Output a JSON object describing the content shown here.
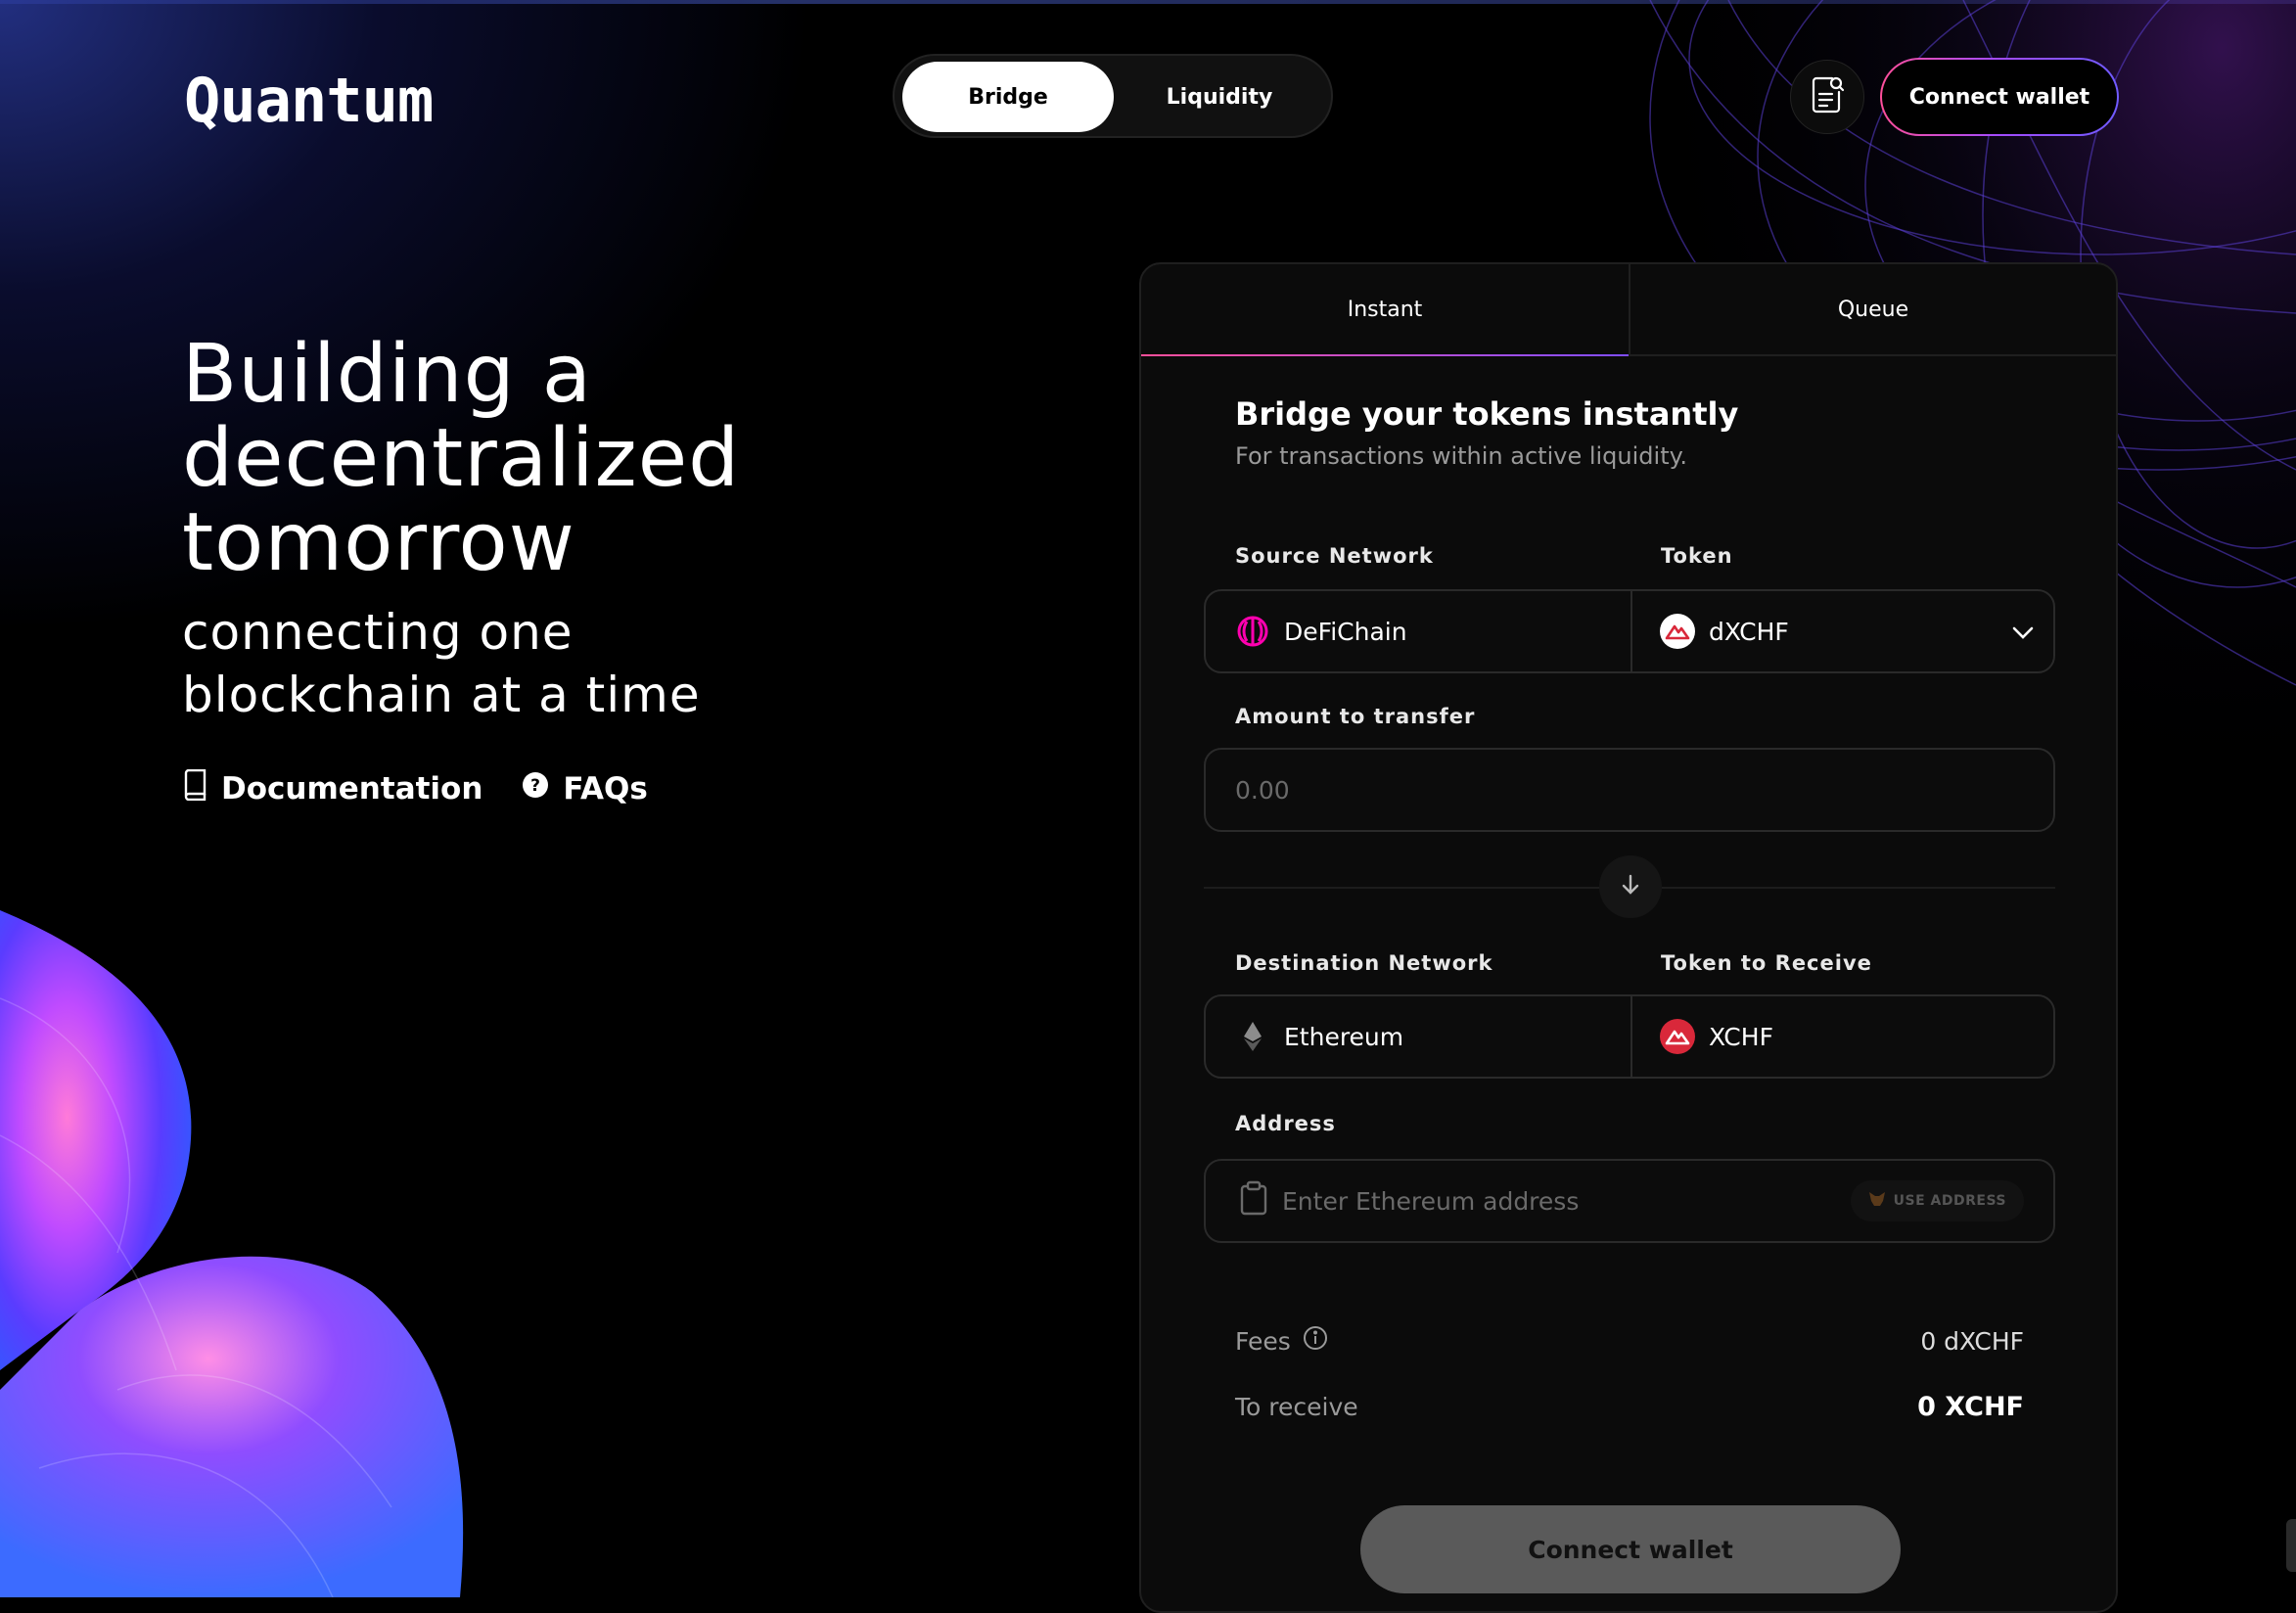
{
  "header": {
    "logo": "Quantum",
    "nav": [
      {
        "label": "Bridge",
        "active": true
      },
      {
        "label": "Liquidity",
        "active": false
      }
    ],
    "connect_wallet": "Connect wallet",
    "doc_icon": "document-search-icon"
  },
  "hero": {
    "title_lines": [
      "Building a",
      "decentralized",
      "tomorrow"
    ],
    "subtitle_lines": [
      "connecting one",
      "blockchain at a time"
    ],
    "links": [
      {
        "label": "Documentation",
        "icon": "book-icon"
      },
      {
        "label": "FAQs",
        "icon": "question-circle-icon"
      }
    ]
  },
  "panel": {
    "tabs": [
      {
        "label": "Instant",
        "active": true
      },
      {
        "label": "Queue",
        "active": false
      }
    ],
    "title": "Bridge your tokens instantly",
    "subtitle": "For transactions within active liquidity.",
    "source_network_label": "Source Network",
    "token_label": "Token",
    "source_network": "DeFiChain",
    "token": "dXCHF",
    "amount_label": "Amount to transfer",
    "amount_placeholder": "0.00",
    "destination_network_label": "Destination Network",
    "token_receive_label": "Token to Receive",
    "destination_network": "Ethereum",
    "token_receive": "XCHF",
    "address_label": "Address",
    "address_placeholder": "Enter Ethereum address",
    "use_address": "USE ADDRESS",
    "fees_label": "Fees",
    "fees_value": "0 dXCHF",
    "receive_label": "To receive",
    "receive_value": "0 XCHF",
    "connect_wallet": "Connect wallet"
  },
  "colors": {
    "accent_pink": "#ff4f9a",
    "accent_purple": "#7f4dff",
    "defichain": "#ff00af",
    "xchf_red": "#d9283a"
  }
}
